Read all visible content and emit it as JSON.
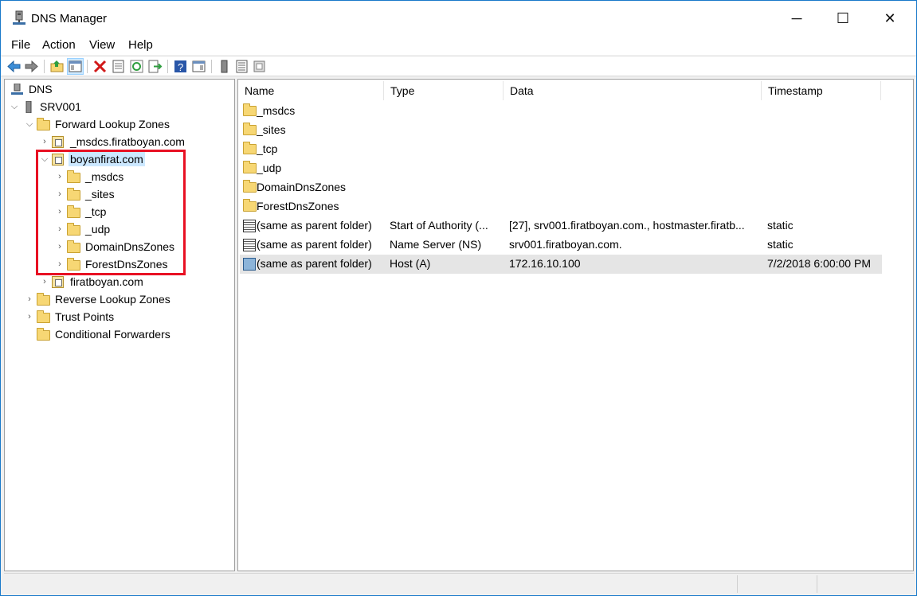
{
  "window": {
    "title": "DNS Manager"
  },
  "title_controls": {
    "minimize": "─",
    "maximize": "☐",
    "close": "✕"
  },
  "menu": [
    "File",
    "Action",
    "View",
    "Help"
  ],
  "toolbar_icons": [
    "back-icon",
    "forward-icon",
    "up-folder-icon",
    "show-hide-tree-icon",
    "delete-icon",
    "properties-icon",
    "refresh-icon",
    "export-list-icon",
    "help-icon",
    "show-hide-action-pane-icon",
    "server-icon",
    "list-icon",
    "zone-icon"
  ],
  "tree": {
    "root": "DNS",
    "server": "SRV001",
    "forward_zones": "Forward Lookup Zones",
    "msdcs_zone": "_msdcs.firatboyan.com",
    "selected_zone": "boyanfirat.com",
    "children": [
      "_msdcs",
      "_sites",
      "_tcp",
      "_udp",
      "DomainDnsZones",
      "ForestDnsZones"
    ],
    "zone2": "firatboyan.com",
    "reverse_zones": "Reverse Lookup Zones",
    "trust_points": "Trust Points",
    "conditional_forwarders": "Conditional Forwarders"
  },
  "list": {
    "columns": [
      "Name",
      "Type",
      "Data",
      "Timestamp"
    ],
    "folders": [
      "_msdcs",
      "_sites",
      "_tcp",
      "_udp",
      "DomainDnsZones",
      "ForestDnsZones"
    ],
    "records": [
      {
        "name": "(same as parent folder)",
        "type": "Start of Authority (...",
        "data": "[27], srv001.firatboyan.com., hostmaster.firatb...",
        "timestamp": "static"
      },
      {
        "name": "(same as parent folder)",
        "type": "Name Server (NS)",
        "data": "srv001.firatboyan.com.",
        "timestamp": "static"
      },
      {
        "name": "(same as parent folder)",
        "type": "Host (A)",
        "data": "172.16.10.100",
        "timestamp": "7/2/2018 6:00:00 PM"
      }
    ]
  },
  "colors": {
    "selection": "#cce8ff",
    "highlight_box": "#e81123",
    "folder": "#f7d774"
  }
}
